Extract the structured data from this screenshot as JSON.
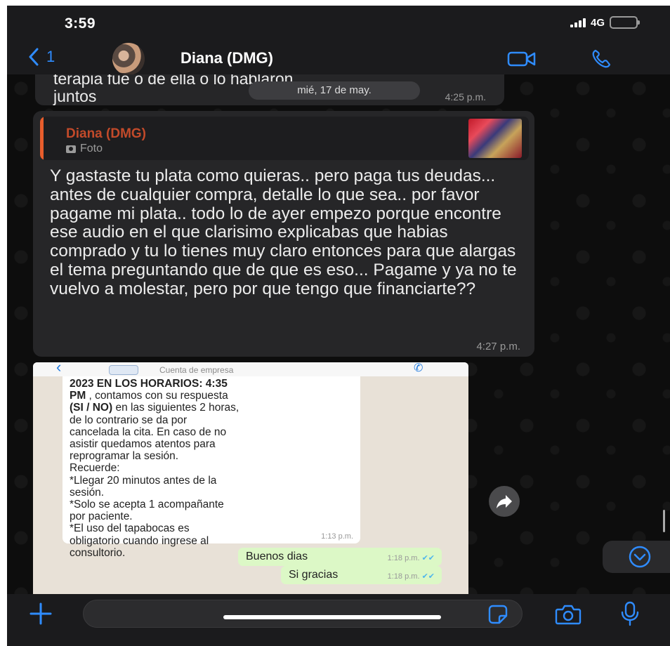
{
  "status_bar": {
    "time": "3:59",
    "network": "4G"
  },
  "nav": {
    "back_count": "1",
    "contact_name": "Diana (DMG)",
    "icons": [
      "chevron-left-icon",
      "video-call-icon",
      "phone-call-icon"
    ]
  },
  "chat": {
    "date_separator": "mié, 17 de may.",
    "message_1": {
      "text_line1": "terapia fue o de ella o lo hablaron",
      "text_line2": "juntos",
      "time": "4:25 p.m."
    },
    "message_2": {
      "quote_author": "Diana (DMG)",
      "quote_type": "Foto",
      "text": "Y gastaste tu plata como quieras.. pero paga tus deudas... antes de cualquier compra, detalle lo que sea.. por favor pagame mi plata.. todo lo de ayer empezo porque encontre ese audio en el que clarisimo explicabas que habias comprado y tu lo tienes muy claro entonces para que alargas el tema preguntando que de que es eso... Pagame y ya no te vuelvo a molestar, pero por que tengo que financiarte??",
      "time": "4:27 p.m."
    },
    "forwarded_image": {
      "business_label": "Cuenta de empresa",
      "incoming": {
        "line1_bold": "2023 EN LOS HORARIOS: 4:35",
        "line2_bold": "PM",
        "line2_rest": " , contamos con su respuesta",
        "line3_bold": "(SI / NO)",
        "line3_rest": " en las siguientes 2 horas,",
        "rest": "de lo contrario se da por\ncancelada la cita. En caso de no\nasistir quedamos atentos para\nreprogramar la sesión.\nRecuerde:\n*Llegar 20 minutos antes de la\nsesión.\n*Solo se acepta 1 acompañante\npor paciente.\n*El uso del tapabocas es\nobligatorio cuando ingrese al\nconsultorio.",
        "time": "1:13 p.m."
      },
      "outgoing": [
        {
          "text": "Buenos dias",
          "time": "1:18 p.m."
        },
        {
          "text": "Si gracias",
          "time": "1:18 p.m."
        }
      ]
    }
  },
  "input": {
    "placeholder": ""
  },
  "colors": {
    "accent": "#2f8cff",
    "quote_bar": "#e85d2c",
    "bubble": "#262628",
    "outgoing_bubble": "#dcf8c6"
  }
}
